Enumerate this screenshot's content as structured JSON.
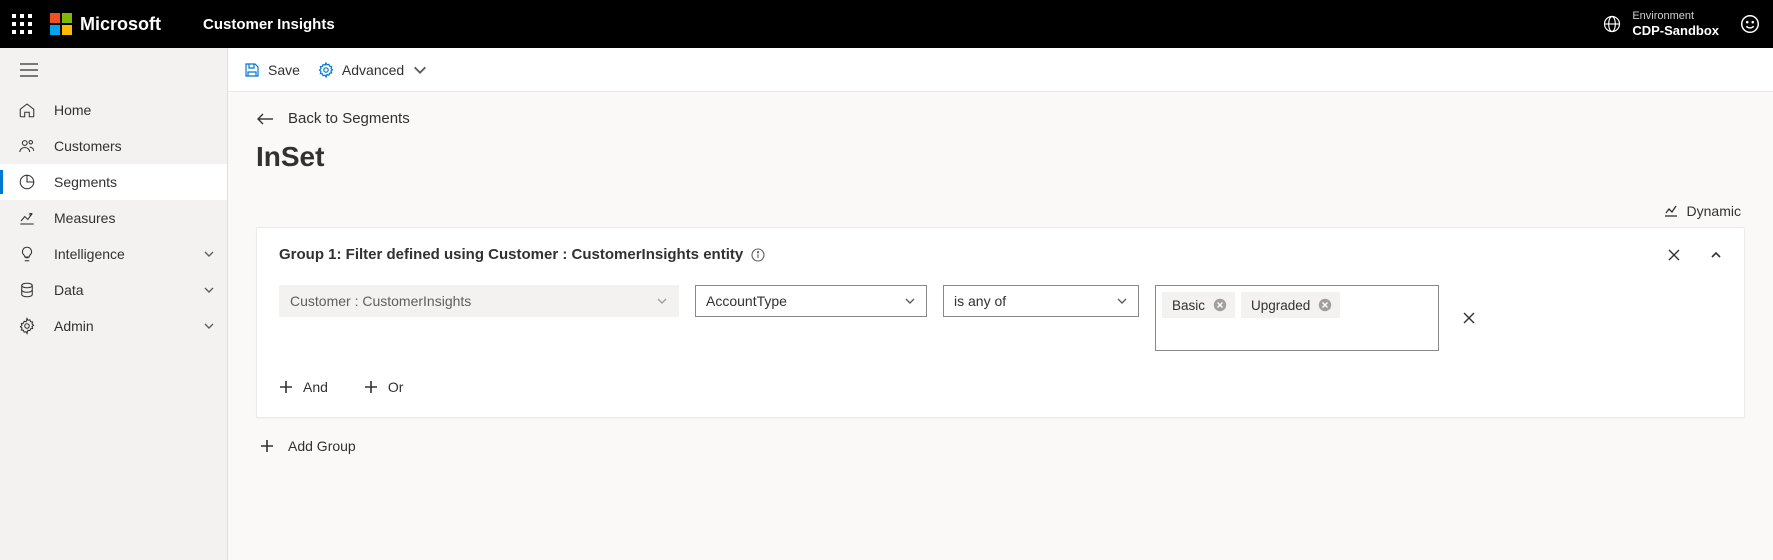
{
  "header": {
    "brand": "Microsoft",
    "app": "Customer Insights",
    "env_label": "Environment",
    "env_name": "CDP-Sandbox"
  },
  "sidebar": {
    "items": [
      {
        "id": "home",
        "label": "Home",
        "expandable": false
      },
      {
        "id": "customers",
        "label": "Customers",
        "expandable": false
      },
      {
        "id": "segments",
        "label": "Segments",
        "expandable": false
      },
      {
        "id": "measures",
        "label": "Measures",
        "expandable": false
      },
      {
        "id": "intelligence",
        "label": "Intelligence",
        "expandable": true
      },
      {
        "id": "data",
        "label": "Data",
        "expandable": true
      },
      {
        "id": "admin",
        "label": "Admin",
        "expandable": true
      }
    ],
    "active": "segments"
  },
  "commandbar": {
    "save": "Save",
    "advanced": "Advanced"
  },
  "page": {
    "back_label": "Back to Segments",
    "title": "InSet",
    "segment_type": "Dynamic"
  },
  "group": {
    "title": "Group 1: Filter defined using Customer : CustomerInsights entity",
    "entity": "Customer : CustomerInsights",
    "attribute": "AccountType",
    "operator": "is any of",
    "values": [
      "Basic",
      "Upgraded"
    ],
    "add_and": "And",
    "add_or": "Or"
  },
  "add_group": "Add Group"
}
